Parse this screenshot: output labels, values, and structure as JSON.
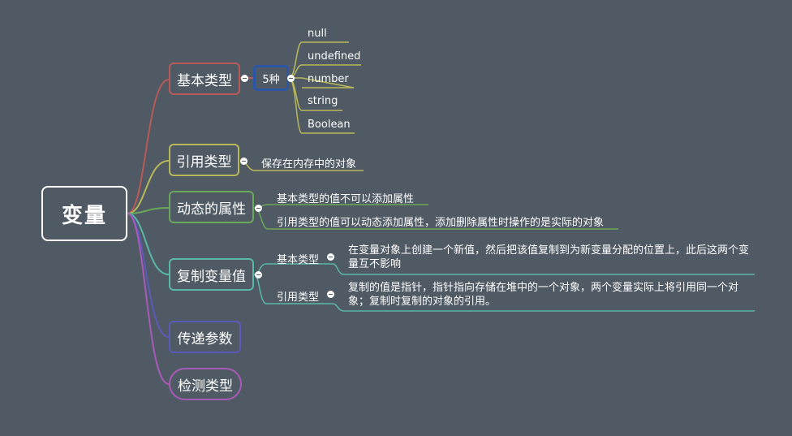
{
  "root": {
    "label": "变量"
  },
  "basic_types": {
    "label": "基本类型",
    "count_label": "5种",
    "items": [
      "null",
      "undefined",
      "number",
      "string",
      "Boolean"
    ]
  },
  "reference_types": {
    "label": "引用类型",
    "note": "保存在内存中的对象"
  },
  "dynamic_props": {
    "label": "动态的属性",
    "notes": [
      "基本类型的值不可以添加属性",
      "引用类型的值可以动态添加属性，添加删除属性时操作的是实际的对象"
    ]
  },
  "copy_values": {
    "label": "复制变量值",
    "basic": {
      "label": "基本类型",
      "text": "在变量对象上创建一个新值，然后把该值复制到为新变量分配的位置上，此后这两个变量互不影响"
    },
    "reference": {
      "label": "引用类型",
      "text": "复制的值是指针，指针指向存储在堆中的一个对象，两个变量实际上将引用同一个对象；复制时复制的对象的引用。"
    }
  },
  "pass_params": {
    "label": "传递参数"
  },
  "detect_types": {
    "label": "检测类型"
  },
  "colors": {
    "background": "#505a64",
    "basic_types": "#b85a5a",
    "reference_types": "#b8b85a",
    "dynamic_props": "#6aa85a",
    "copy_values": "#5ab8a8",
    "pass_params": "#5a5ab8",
    "detect_types": "#a85ab8",
    "box5": "#2b56a8"
  }
}
